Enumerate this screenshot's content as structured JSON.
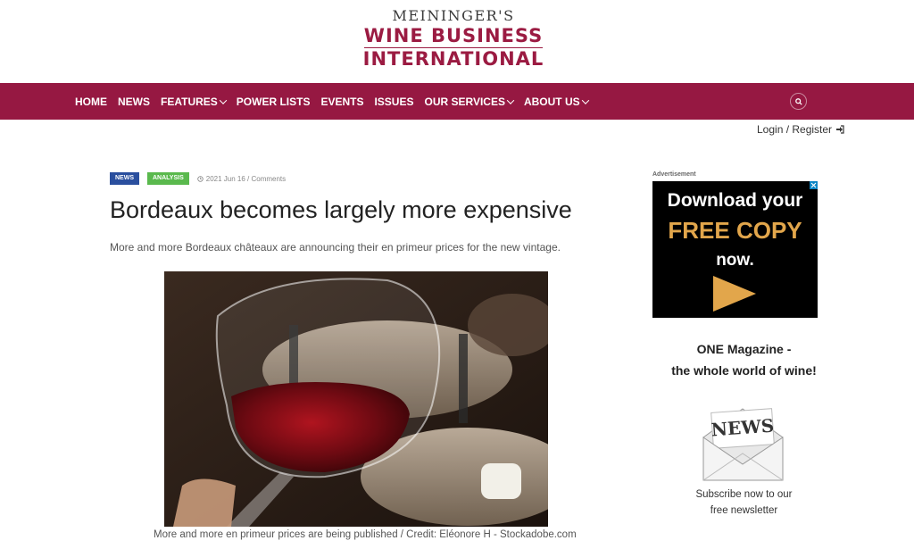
{
  "logo": {
    "line1": "MEININGER'S",
    "line2": "WINE BUSINESS",
    "line3": "INTERNATIONAL"
  },
  "nav": {
    "items": [
      {
        "label": "HOME",
        "dropdown": false
      },
      {
        "label": "NEWS",
        "dropdown": false
      },
      {
        "label": "FEATURES",
        "dropdown": true
      },
      {
        "label": "POWER LISTS",
        "dropdown": false
      },
      {
        "label": "EVENTS",
        "dropdown": false
      },
      {
        "label": "ISSUES",
        "dropdown": false
      },
      {
        "label": "OUR SERVICES",
        "dropdown": true
      },
      {
        "label": "ABOUT US",
        "dropdown": true
      }
    ],
    "search_icon": "search-icon"
  },
  "account": {
    "login_label": "Login / Register",
    "icon": "sign-in-icon"
  },
  "article": {
    "tags": [
      "NEWS",
      "ANALYSIS"
    ],
    "date": "2021 Jun 16 / Comments",
    "title": "Bordeaux becomes largely more expensive",
    "lead": "More and more Bordeaux châteaux are announcing their en primeur prices for the new vintage.",
    "caption": "More and more en primeur prices are being published / Credit: Eléonore H - Stockadobe.com"
  },
  "sidebar": {
    "ad_label": "Advertisement",
    "ad": {
      "line1": "Download your",
      "line2": "FREE COPY",
      "line3": "now."
    },
    "magazine": {
      "line1": "ONE Magazine -",
      "line2": "the whole world of wine!"
    },
    "newsletter": {
      "image_text": "NEWS",
      "line1": "Subscribe now to our",
      "line2": "free newsletter"
    }
  },
  "colors": {
    "brand": "#961842",
    "news_badge": "#2a4f9e",
    "analysis_badge": "#5ab94d",
    "ad_accent": "#e2a64b"
  }
}
